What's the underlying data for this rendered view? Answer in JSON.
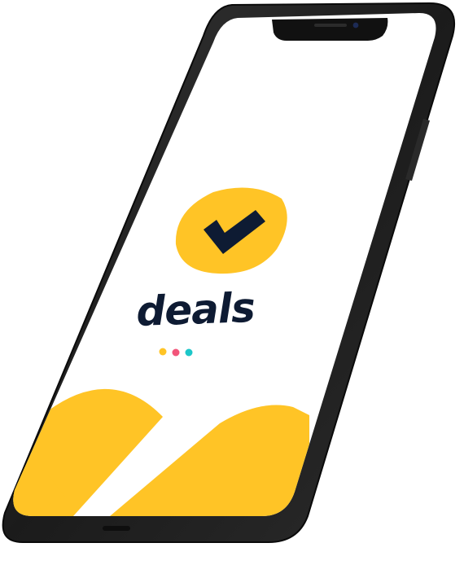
{
  "app": {
    "name": "deals"
  },
  "colors": {
    "brand_yellow": "#FFC426",
    "brand_navy": "#0E1B33",
    "screen_bg": "#FFFFFF",
    "frame": "#1E1E1E",
    "frame_edge": "#0A0A0A",
    "dot_yellow": "#FFC426",
    "dot_pink": "#F2557A",
    "dot_teal": "#1CC7C9"
  },
  "icons": {
    "logo": "check-badge-icon",
    "loader": "loading-dots-icon"
  }
}
